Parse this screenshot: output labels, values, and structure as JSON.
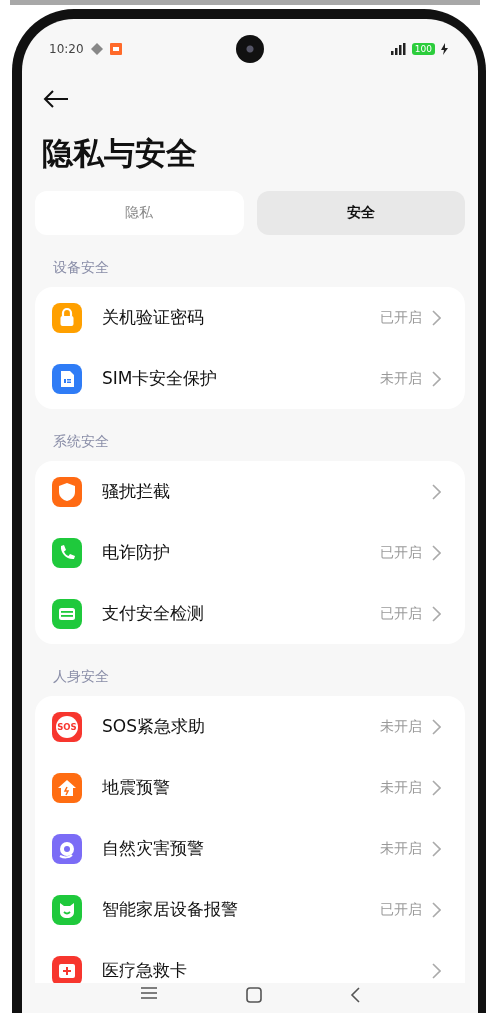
{
  "status_bar": {
    "time": "10:20",
    "battery": "100"
  },
  "title": "隐私与安全",
  "tabs": [
    {
      "label": "隐私",
      "selected": false
    },
    {
      "label": "安全",
      "selected": true
    }
  ],
  "sections": [
    {
      "heading": "设备安全",
      "items": [
        {
          "label": "关机验证密码",
          "status": "已开启",
          "kind": "lock",
          "color": "#ffa000"
        },
        {
          "label": "SIM卡安全保护",
          "status": "未开启",
          "kind": "sim",
          "color": "#2f7cf6"
        }
      ]
    },
    {
      "heading": "系统安全",
      "items": [
        {
          "label": "骚扰拦截",
          "kind": "shield",
          "color": "#ff6a13"
        },
        {
          "label": "电诈防护",
          "status": "已开启",
          "kind": "phone",
          "color": "#1fc93c"
        },
        {
          "label": "支付安全检测",
          "status": "已开启",
          "kind": "card",
          "color": "#1fc93c"
        }
      ]
    },
    {
      "heading": "人身安全",
      "items": [
        {
          "label": "SOS紧急求助",
          "status": "未开启",
          "kind": "sos",
          "color": "#f7362e",
          "icon_text": "SOS"
        },
        {
          "label": "地震预警",
          "status": "未开启",
          "kind": "house",
          "color": "#ff6d12"
        },
        {
          "label": "自然灾害预警",
          "status": "未开启",
          "kind": "storm",
          "color": "#7b6cf6"
        },
        {
          "label": "智能家居设备报警",
          "status": "已开启",
          "kind": "cat",
          "color": "#1fc93c"
        },
        {
          "label": "医疗急救卡",
          "kind": "medical",
          "color": "#f7362e"
        }
      ]
    }
  ]
}
